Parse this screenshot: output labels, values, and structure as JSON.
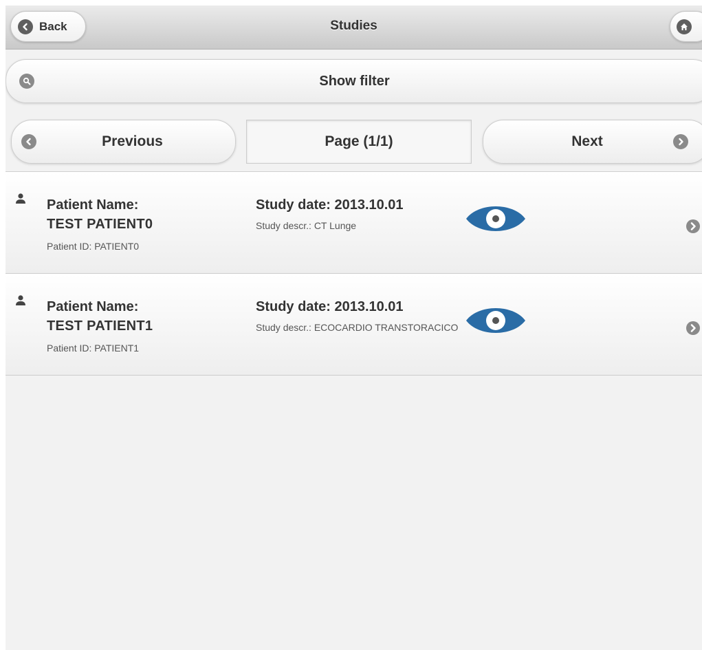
{
  "header": {
    "title": "Studies",
    "back_label": "Back",
    "back_icon": "chevron-left-icon",
    "home_icon": "home-icon"
  },
  "filter": {
    "label": "Show filter",
    "icon": "search-icon"
  },
  "pager": {
    "previous_label": "Previous",
    "next_label": "Next",
    "page_label": "Page (1/1)"
  },
  "studies": [
    {
      "patient_name_label": "Patient Name:",
      "patient_name": "TEST PATIENT0",
      "patient_id": "Patient ID: PATIENT0",
      "study_date": "Study date: 2013.10.01",
      "study_description": "Study descr.: CT Lunge"
    },
    {
      "patient_name_label": "Patient Name:",
      "patient_name": "TEST PATIENT1",
      "patient_id": "Patient ID: PATIENT1",
      "study_date": "Study date: 2013.10.01",
      "study_description": "Study descr.: ECOCARDIO TRANSTORACICO"
    }
  ],
  "colors": {
    "eye_icon": "#2a6ca6",
    "icon_gray": "#8a8a8a",
    "text": "#333333"
  }
}
